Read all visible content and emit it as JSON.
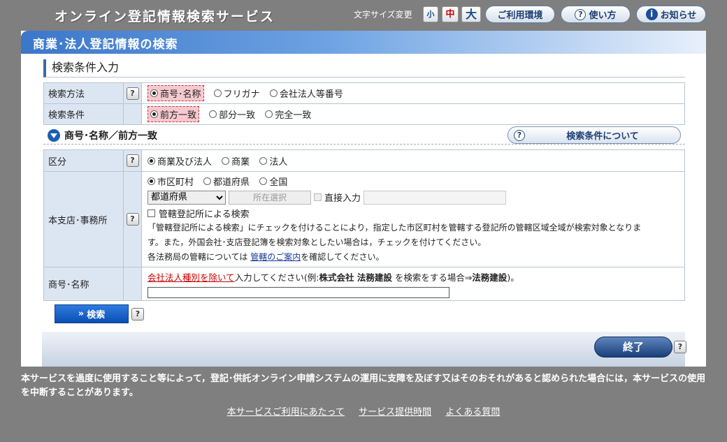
{
  "header": {
    "site_title": "オンライン登記情報検索サービス",
    "font_size_label": "文字サイズ変更",
    "font_small": "小",
    "font_medium": "中",
    "font_large": "大",
    "env_label": "ご利用環境",
    "howto_label": "使い方",
    "notice_label": "お知らせ"
  },
  "panel": {
    "title": "商業･法人登記情報の検索",
    "section_title": "検索条件入力"
  },
  "search_method": {
    "label": "検索方法",
    "options": [
      "商号･名称",
      "フリガナ",
      "会社法人等番号"
    ],
    "selected": 0
  },
  "search_condition": {
    "label": "検索条件",
    "options": [
      "前方一致",
      "部分一致",
      "完全一致"
    ],
    "selected": 0
  },
  "condition_bar": {
    "title": "商号･名称／前方一致",
    "about_label": "検索条件について"
  },
  "kubun": {
    "label": "区分",
    "options": [
      "商業及び法人",
      "商業",
      "法人"
    ],
    "selected": 0
  },
  "office": {
    "label": "本支店･事務所",
    "scope_options": [
      "市区町村",
      "都道府県",
      "全国"
    ],
    "selected": 0,
    "prefecture_select": "都道府県",
    "location_button": "所在選択",
    "direct_input_label": "直接入力",
    "jurisdiction_checkbox": "管轄登記所による検索",
    "note1": "「管轄登記所による検索」にチェックを付けることにより，指定した市区町村を管轄する登記所の管轄区域全域が検索対象となりま",
    "note2": "す。また，外国会社･支店登記簿を検索対象としたい場合は，チェックを付けてください。",
    "note3_prefix": "各法務局の管轄については",
    "note3_link": "管轄のご案内",
    "note3_suffix": "を確認してください。"
  },
  "name": {
    "label": "商号･名称",
    "hint_link": "会社法人種別を除いて",
    "hint_a": "入力してください(例:",
    "hint_b": "株式会社 法務建設",
    "hint_c": " を検索をする場合⇒",
    "hint_d": "法務建設",
    "hint_e": ")。",
    "value": ""
  },
  "actions": {
    "search": "検索",
    "end": "終了"
  },
  "footer": {
    "notice": "本サービスを過度に使用すること等によって，登記･供託オンライン申請システムの運用に支障を及ぼす又はそのおそれがあると認められた場合には，本サービスの使用を中断することがあります。",
    "links": [
      "本サービスご利用にあたって",
      "サービス提供時間",
      "よくある質問"
    ]
  }
}
